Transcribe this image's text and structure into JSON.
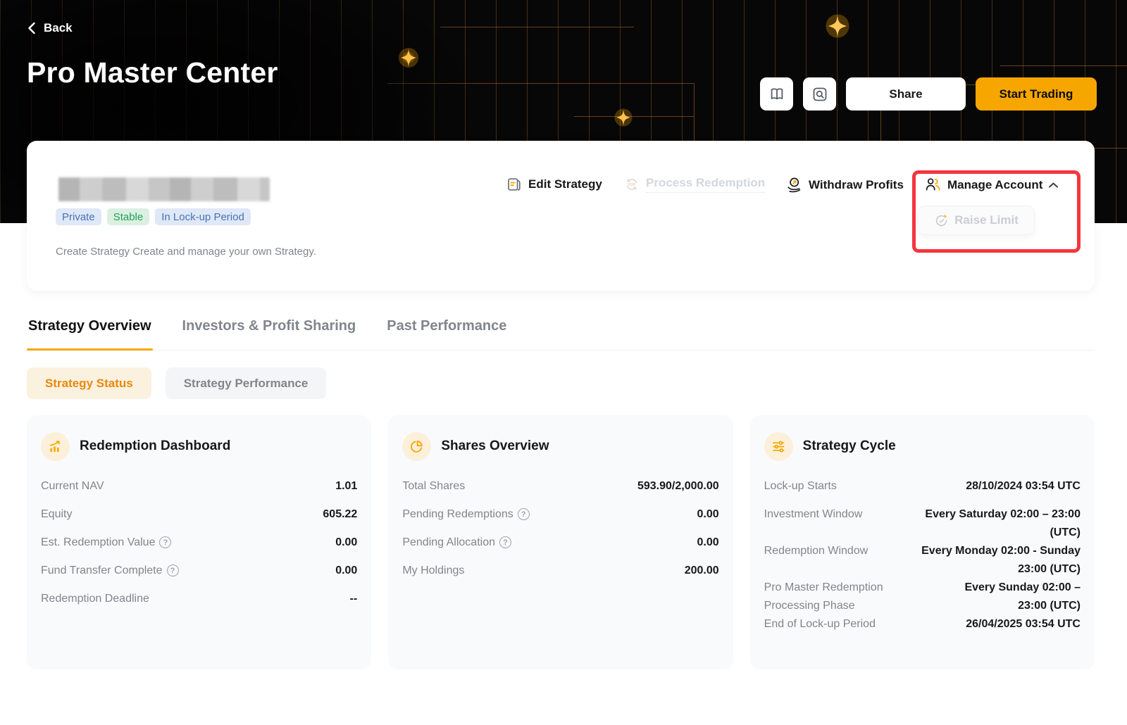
{
  "header": {
    "back_label": "Back",
    "title": "Pro Master Center",
    "share_label": "Share",
    "start_trading_label": "Start Trading"
  },
  "strategy": {
    "name_redacted": true,
    "badges": [
      {
        "label": "Private",
        "style": "blue"
      },
      {
        "label": "Stable",
        "style": "green"
      },
      {
        "label": "In Lock-up Period",
        "style": "blue"
      }
    ],
    "description": "Create Strategy Create and manage your own Strategy.",
    "actions": {
      "edit": "Edit Strategy",
      "process": "Process Redemption",
      "process_disabled": true,
      "withdraw": "Withdraw Profits",
      "manage": "Manage Account",
      "raise_limit": "Raise Limit",
      "raise_limit_disabled": true
    }
  },
  "tabs": [
    {
      "label": "Strategy Overview",
      "active": true
    },
    {
      "label": "Investors & Profit Sharing",
      "active": false
    },
    {
      "label": "Past Performance",
      "active": false
    }
  ],
  "subtabs": [
    {
      "label": "Strategy Status",
      "active": true
    },
    {
      "label": "Strategy Performance",
      "active": false
    }
  ],
  "cards": [
    {
      "title": "Redemption Dashboard",
      "icon": "bar-chart-up-icon",
      "rows": [
        {
          "label": "Current NAV",
          "value": "1.01"
        },
        {
          "label": "Equity",
          "value": "605.22"
        },
        {
          "label": "Est. Redemption Value",
          "value": "0.00",
          "help": true
        },
        {
          "label": "Fund Transfer Complete",
          "value": "0.00",
          "help": true
        },
        {
          "label": "Redemption Deadline",
          "value": "--"
        }
      ]
    },
    {
      "title": "Shares Overview",
      "icon": "pie-chart-icon",
      "rows": [
        {
          "label": "Total Shares",
          "value": "593.90/2,000.00"
        },
        {
          "label": "Pending Redemptions",
          "value": "0.00",
          "help": true
        },
        {
          "label": "Pending Allocation",
          "value": "0.00",
          "help": true
        },
        {
          "label": "My Holdings",
          "value": "200.00"
        }
      ]
    },
    {
      "title": "Strategy Cycle",
      "icon": "sliders-icon",
      "rows": [
        {
          "label": "Lock-up Starts",
          "value": "28/10/2024 03:54 UTC"
        },
        {
          "label": "Investment Window",
          "value": "Every Saturday 02:00 – 23:00 (UTC)"
        },
        {
          "label": "Redemption Window",
          "value": "Every Monday 02:00 - Sunday 23:00 (UTC)"
        },
        {
          "label": "Pro Master Redemption Processing Phase",
          "value": "Every Sunday 02:00 – 23:00 (UTC)"
        },
        {
          "label": "End of Lock-up Period",
          "value": "26/04/2025 03:54 UTC"
        }
      ]
    }
  ],
  "icons": {
    "help": "?"
  },
  "colors": {
    "accent_orange": "#F7A600",
    "annotation_red": "#F5353D",
    "badge_blue_bg": "#DFE8F7",
    "badge_blue_text": "#4A71B5",
    "badge_green_bg": "#DCF0E2",
    "badge_green_text": "#1FA05A",
    "hero_bg": "#070708",
    "disabled_text": "#D3D7DC"
  }
}
